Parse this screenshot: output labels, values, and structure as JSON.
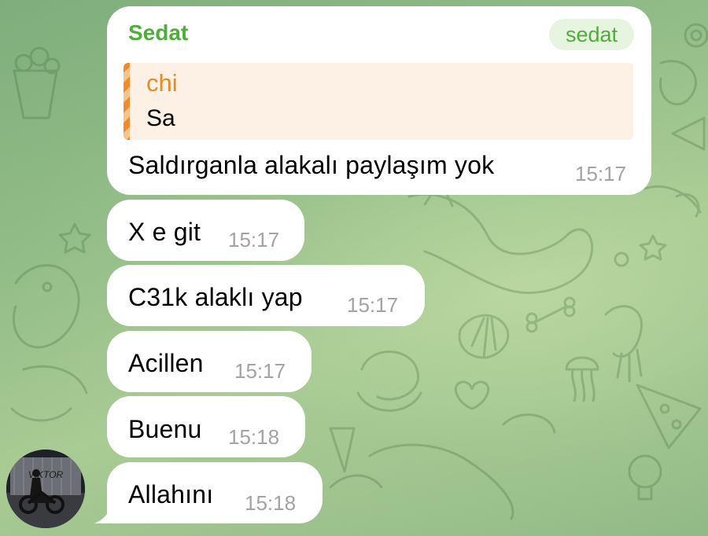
{
  "chat": {
    "first_message": {
      "sender": "Sedat",
      "sender_tag": "sedat",
      "reply": {
        "name": "chi",
        "text": "Sa"
      },
      "text": "Saldırganla alakalı paylaşım yok",
      "time": "15:17"
    },
    "messages": [
      {
        "text": "X e git",
        "time": "15:17"
      },
      {
        "text": "C31k alaklı yap",
        "time": "15:17"
      },
      {
        "text": "Acillen",
        "time": "15:17"
      },
      {
        "text": "Buenu",
        "time": "15:18"
      },
      {
        "text": "Allahını",
        "time": "15:18"
      }
    ],
    "avatar_sign_text": "VIKTOR"
  },
  "colors": {
    "sender_name": "#4fad3a",
    "quote_name": "#e48b26",
    "quote_background": "#fdf0e4",
    "time": "#a3a3a3",
    "bubble": "#ffffff",
    "wallpaper": "#9cc290"
  },
  "icons": [
    "doodle-wallpaper",
    "avatar-photo"
  ]
}
